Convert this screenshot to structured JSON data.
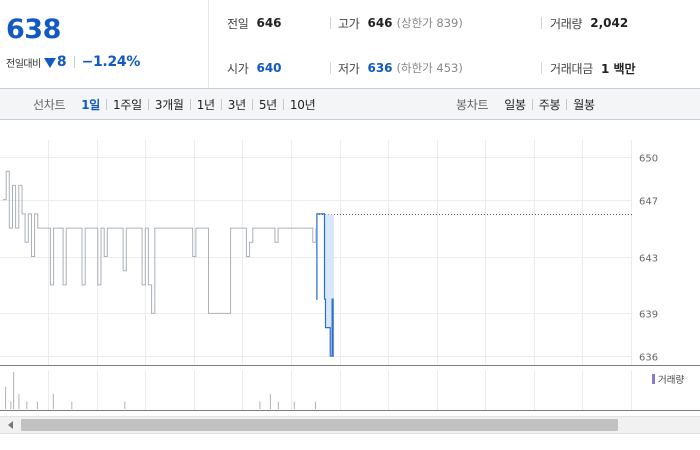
{
  "quote": {
    "price": "638",
    "change_label": "전일대비",
    "change_value": "8",
    "change_pct": "−1.24%",
    "stats": {
      "prev_close_label": "전일",
      "prev_close": "646",
      "high_label": "고가",
      "high": "646",
      "upper_limit": "(상한가 839)",
      "volume_label": "거래량",
      "volume": "2,042",
      "open_label": "시가",
      "open": "640",
      "low_label": "저가",
      "low": "636",
      "lower_limit": "(하한가 453)",
      "amount_label": "거래대금",
      "amount": "1 백만"
    }
  },
  "tabs": {
    "line_chart_label": "선차트",
    "line_periods": [
      "1일",
      "1주일",
      "3개월",
      "1년",
      "3년",
      "5년",
      "10년"
    ],
    "active_index": 0,
    "candle_chart_label": "봉차트",
    "candle_periods": [
      "일봉",
      "주봉",
      "월봉"
    ]
  },
  "colors": {
    "accent": "#1259c3",
    "line_prev": "#aab0b8",
    "line_today": "#2f6fcf",
    "fill_today": "#d9e7fb",
    "volume_legend": "#8a7bd0"
  },
  "chart_data": {
    "type": "line",
    "yticks": [
      "650",
      "647",
      "643",
      "639",
      "636"
    ],
    "ylim": [
      636,
      650
    ],
    "reference_line": 646,
    "grid": true,
    "series": [
      {
        "values": [
          647,
          649,
          645,
          648,
          645,
          648,
          646,
          644,
          646,
          643,
          646,
          645,
          645,
          645,
          645,
          641,
          645,
          645,
          645,
          641,
          645,
          645,
          645,
          645,
          645,
          641,
          645,
          645,
          645,
          645,
          641,
          645,
          643,
          645,
          645,
          645,
          645,
          645,
          642,
          645,
          645,
          645,
          645,
          645,
          641,
          645,
          641,
          639,
          645,
          645,
          645,
          645,
          645,
          645,
          645,
          645,
          645,
          645,
          645,
          645,
          643,
          645,
          645,
          645,
          645,
          639,
          639,
          639,
          639,
          639,
          639,
          639,
          645,
          645,
          645,
          645,
          645,
          643,
          644,
          645,
          645,
          645,
          645,
          645,
          645,
          645,
          644,
          645,
          645,
          645,
          645,
          645,
          645,
          645,
          645,
          645,
          645,
          645,
          644,
          645
        ]
      },
      {
        "values": [
          640,
          646,
          646,
          646,
          646,
          646,
          646,
          646,
          646,
          640,
          638,
          638,
          638,
          638,
          638,
          636,
          636,
          640,
          636,
          636
        ]
      }
    ],
    "volume": {
      "legend": "거래량",
      "values": [
        0,
        3,
        0,
        1,
        5,
        0,
        2,
        0,
        0,
        1,
        0,
        0,
        0,
        1,
        0,
        0,
        0,
        0,
        0,
        2,
        0,
        0,
        0,
        0,
        0,
        0,
        1,
        0,
        0,
        0,
        0,
        0,
        0,
        0,
        0,
        0,
        0,
        0,
        0,
        0,
        0,
        0,
        0,
        0,
        0,
        0,
        1,
        0,
        0,
        0,
        0,
        0,
        0,
        0,
        0,
        0,
        0,
        0,
        0,
        0,
        0,
        0,
        0,
        0,
        0,
        0,
        0,
        0,
        0,
        0,
        0,
        0,
        0,
        0,
        0,
        0,
        0,
        0,
        0,
        0,
        0,
        0,
        0,
        0,
        0,
        0,
        0,
        0,
        0,
        0,
        0,
        0,
        0,
        0,
        0,
        0,
        0,
        1,
        0,
        0,
        0,
        2,
        0,
        0,
        1,
        0,
        0,
        0,
        0,
        0,
        1,
        0,
        0,
        0,
        0,
        0,
        0,
        0,
        1,
        0,
        0,
        0,
        0,
        0,
        0,
        0
      ]
    }
  },
  "volume_legend_label": "거래량"
}
